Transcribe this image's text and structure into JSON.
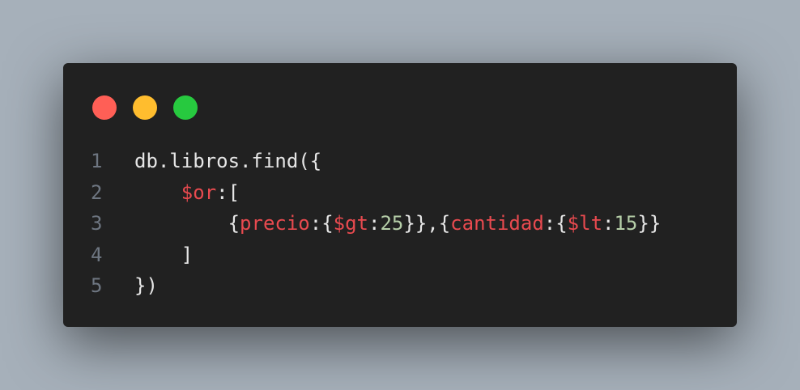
{
  "window_controls": {
    "close_color": "#ff5f56",
    "minimize_color": "#ffbd2e",
    "maximize_color": "#27c93f"
  },
  "colors": {
    "background": "#a6b0ba",
    "editor_bg": "#212121",
    "line_number": "#6e7681",
    "plain": "#e6e6e6",
    "key": "#e84a4f",
    "number": "#b5cea8"
  },
  "code": {
    "lines": [
      {
        "number": "1",
        "tokens": [
          {
            "text": "db.libros.find({",
            "type": "plain"
          }
        ]
      },
      {
        "number": "2",
        "tokens": [
          {
            "text": "    ",
            "type": "plain"
          },
          {
            "text": "$or",
            "type": "key"
          },
          {
            "text": ":[",
            "type": "plain"
          }
        ]
      },
      {
        "number": "3",
        "tokens": [
          {
            "text": "        {",
            "type": "plain"
          },
          {
            "text": "precio",
            "type": "key"
          },
          {
            "text": ":{",
            "type": "plain"
          },
          {
            "text": "$gt",
            "type": "key"
          },
          {
            "text": ":",
            "type": "plain"
          },
          {
            "text": "25",
            "type": "num"
          },
          {
            "text": "}},{",
            "type": "plain"
          },
          {
            "text": "cantidad",
            "type": "key"
          },
          {
            "text": ":{",
            "type": "plain"
          },
          {
            "text": "$lt",
            "type": "key"
          },
          {
            "text": ":",
            "type": "plain"
          },
          {
            "text": "15",
            "type": "num"
          },
          {
            "text": "}}",
            "type": "plain"
          }
        ]
      },
      {
        "number": "4",
        "tokens": [
          {
            "text": "    ]",
            "type": "plain"
          }
        ]
      },
      {
        "number": "5",
        "tokens": [
          {
            "text": "})",
            "type": "plain"
          }
        ]
      }
    ]
  }
}
